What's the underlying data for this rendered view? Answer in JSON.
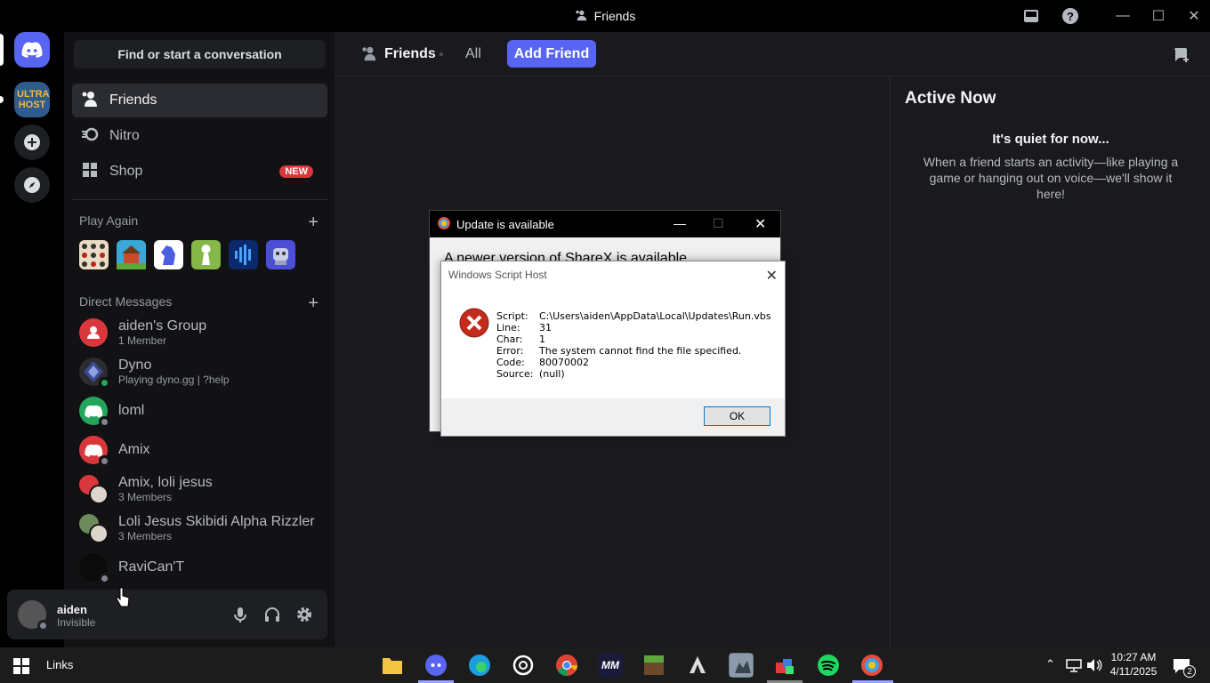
{
  "window": {
    "title": "Friends",
    "accent": "#5865f2"
  },
  "guilds": [
    {
      "name": "discord-home",
      "label": ""
    },
    {
      "name": "ultra-host",
      "label": "ULTRA HOST"
    }
  ],
  "sidebar": {
    "search_placeholder": "Find or start a conversation",
    "nav": [
      {
        "label": "Friends",
        "icon": "friends-icon",
        "active": true
      },
      {
        "label": "Nitro",
        "icon": "nitro-icon"
      },
      {
        "label": "Shop",
        "icon": "shop-icon",
        "badge": "NEW"
      }
    ],
    "play_again_label": "Play Again",
    "dm_label": "Direct Messages",
    "dms": [
      {
        "name": "aiden's Group",
        "sub": "1 Member",
        "color": "#da373c"
      },
      {
        "name": "Dyno",
        "sub": "Playing dyno.gg | ?help",
        "color": "#2b2d31",
        "status": "#23a55a"
      },
      {
        "name": "loml",
        "sub": "",
        "color": "#23a55a",
        "status": "#80848e"
      },
      {
        "name": "Amix",
        "sub": "",
        "color": "#da373c",
        "status": "#80848e"
      },
      {
        "name": "Amix, loli jesus",
        "sub": "3 Members",
        "color": "#da373c"
      },
      {
        "name": "Loli Jesus Skibidi Alpha Rizzler",
        "sub": "3 Members",
        "color": "#6d8a5a"
      },
      {
        "name": "RaviCan'T",
        "sub": "",
        "color": "#0b0b0b",
        "status": "#80848e"
      }
    ]
  },
  "user": {
    "name": "aiden",
    "status": "Invisible"
  },
  "header": {
    "title": "Friends",
    "tab_all": "All",
    "add_friend": "Add Friend"
  },
  "active_now": {
    "title": "Active Now",
    "quiet": "It's quiet for now...",
    "desc": "When a friend starts an activity—like playing a game or hanging out on voice—we'll show it here!"
  },
  "sharex_dialog": {
    "title": "Update is available",
    "body": "A newer version of ShareX is available"
  },
  "script_dialog": {
    "title": "Windows Script Host",
    "rows": [
      {
        "k": "Script:",
        "v": "C:\\Users\\aiden\\AppData\\Local\\Updates\\Run.vbs"
      },
      {
        "k": "Line:",
        "v": "31"
      },
      {
        "k": "Char:",
        "v": "1"
      },
      {
        "k": "Error:",
        "v": "The system cannot find the file specified."
      },
      {
        "k": "Code:",
        "v": "80070002"
      },
      {
        "k": "Source:",
        "v": "(null)"
      }
    ],
    "ok": "OK"
  },
  "taskbar": {
    "links": "Links",
    "time": "10:27 AM",
    "date": "4/11/2025",
    "notif_count": "2"
  }
}
